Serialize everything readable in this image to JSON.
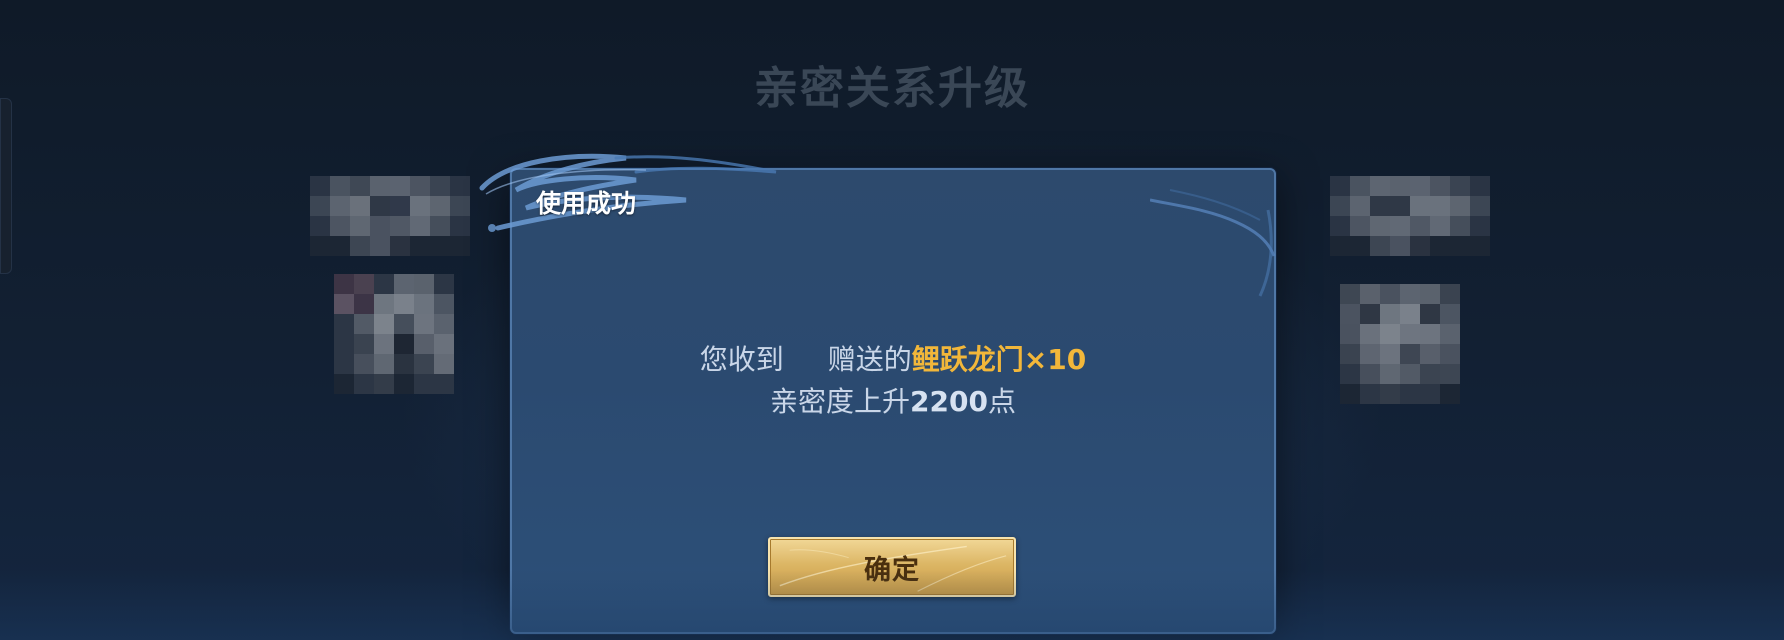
{
  "background": {
    "title": "亲密关系升级",
    "left_avatar_icon": "pixelated-avatar-icon",
    "right_avatar_icon": "pixelated-avatar-icon"
  },
  "dialog": {
    "title": "使用成功",
    "message": {
      "prefix": "您收到",
      "middle": "赠送的",
      "item": "鲤跃龙门",
      "quantity": "×10",
      "line2_prefix": "亲密度上升",
      "points": "2200",
      "line2_suffix": "点"
    },
    "confirm_label": "确定"
  },
  "colors": {
    "accent_gold": "#f2b73a",
    "button_gold": "#dcb665",
    "dialog_blue": "#2d4a6d"
  }
}
